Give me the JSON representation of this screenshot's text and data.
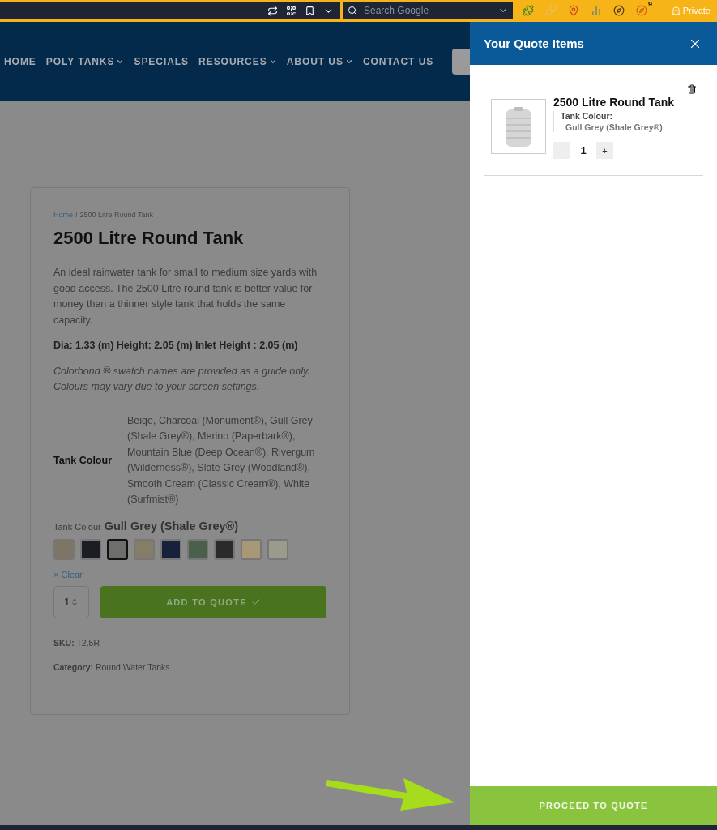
{
  "browser_bar": {
    "search_placeholder": "Search Google",
    "extension_badge": "9",
    "private_label": "Private"
  },
  "nav": {
    "items": [
      {
        "label": "HOME",
        "dropdown": false
      },
      {
        "label": "POLY TANKS",
        "dropdown": true
      },
      {
        "label": "SPECIALS",
        "dropdown": false
      },
      {
        "label": "RESOURCES",
        "dropdown": true
      },
      {
        "label": "ABOUT US",
        "dropdown": true
      },
      {
        "label": "CONTACT US",
        "dropdown": false
      }
    ]
  },
  "breadcrumb": {
    "link": "Home",
    "separator": "/",
    "current": "2500 Litre Round Tank"
  },
  "product": {
    "title": "2500 Litre Round Tank",
    "description": "An ideal rainwater tank for small to medium size yards with good access.  The 2500 Litre round tank is better value for money than a thinner style tank that holds the same capacity.",
    "dimensions": "Dia: 1.33 (m) Height: 2.05 (m) Inlet Height : 2.05 (m)",
    "note": "Colorbond ® swatch names are provided as a guide only. Colours may vary due to your screen settings.",
    "attributes": [
      {
        "label": "Tank Colour",
        "value": "Beige, Charcoal (Monument®), Gull Grey (Shale Grey®), Merino (Paperbark®), Mountain Blue (Deep Ocean®), Rivergum (Wilderness®), Slate Grey (Woodland®), Smooth Cream (Classic Cream®), White (Surfmist®)"
      }
    ],
    "colour_label": "Tank Colour",
    "colour_value": "Gull Grey (Shale Grey®)",
    "swatches": [
      {
        "color": "#7e7566",
        "selected": false
      },
      {
        "color": "#1b1d24",
        "selected": false
      },
      {
        "color": "#6e6f6c",
        "selected": true
      },
      {
        "color": "#857d68",
        "selected": false
      },
      {
        "color": "#18213a",
        "selected": false
      },
      {
        "color": "#4a5f4c",
        "selected": false
      },
      {
        "color": "#2a2a2a",
        "selected": false
      },
      {
        "color": "#a99877",
        "selected": false
      },
      {
        "color": "#9c9a8c",
        "selected": false
      }
    ],
    "clear_icon": "×",
    "clear_label": "Clear",
    "quantity": "1",
    "add_button": "ADD TO QUOTE",
    "sku_label": "SKU:",
    "sku": "T2.5R",
    "category_label": "Category:",
    "category": "Round Water Tanks"
  },
  "drawer": {
    "title": "Your Quote Items",
    "items": [
      {
        "name": "2500 Litre Round Tank",
        "attr_label": "Tank Colour:",
        "attr_value": "Gull Grey (Shale Grey®)",
        "minus": "-",
        "quantity": "1",
        "plus": "+"
      }
    ],
    "proceed_button": "PROCEED TO QUOTE"
  }
}
